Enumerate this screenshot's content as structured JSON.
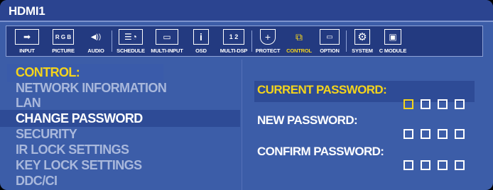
{
  "header": {
    "title": "HDMI1"
  },
  "tabs": [
    {
      "label": "INPUT",
      "icon": "input-icon",
      "glyph": "➡"
    },
    {
      "label": "PICTURE",
      "icon": "picture-rgb-icon",
      "glyph": "R G B"
    },
    {
      "label": "AUDIO",
      "icon": "speaker-icon",
      "glyph": "◀))"
    },
    {
      "label": "SCHEDULE",
      "icon": "schedule-clock-icon",
      "glyph": "☰◔"
    },
    {
      "label": "MULTI-INPUT",
      "icon": "multi-input-icon",
      "glyph": "▭"
    },
    {
      "label": "OSD",
      "icon": "info-icon",
      "glyph": "i"
    },
    {
      "label": "MULTI-DSP",
      "icon": "multi-display-icon",
      "glyph": "1 2"
    },
    {
      "label": "PROTECT",
      "icon": "shield-icon",
      "glyph": "+"
    },
    {
      "label": "CONTROL",
      "icon": "control-network-icon",
      "glyph": "⧉"
    },
    {
      "label": "OPTION",
      "icon": "option-icon",
      "glyph": "▭"
    },
    {
      "label": "SYSTEM",
      "icon": "system-gear-icon",
      "glyph": "⚙"
    },
    {
      "label": "C MODULE",
      "icon": "compute-module-icon",
      "glyph": "▣"
    }
  ],
  "active_tab": "CONTROL",
  "menu": {
    "heading": "CONTROL:",
    "items": [
      "NETWORK INFORMATION",
      "LAN",
      "CHANGE PASSWORD",
      "SECURITY",
      "IR LOCK SETTINGS",
      "KEY LOCK SETTINGS",
      "DDC/CI"
    ],
    "selected": "CHANGE PASSWORD"
  },
  "password": {
    "current_label": "CURRENT PASSWORD:",
    "new_label": "NEW PASSWORD:",
    "confirm_label": "CONFIRM PASSWORD:",
    "digits_per_field": 4
  },
  "colors": {
    "background": "#3c5da8",
    "title_bar": "#2b4490",
    "highlight_text": "#f4d41c",
    "dimmed_text": "#a9b8dc"
  }
}
